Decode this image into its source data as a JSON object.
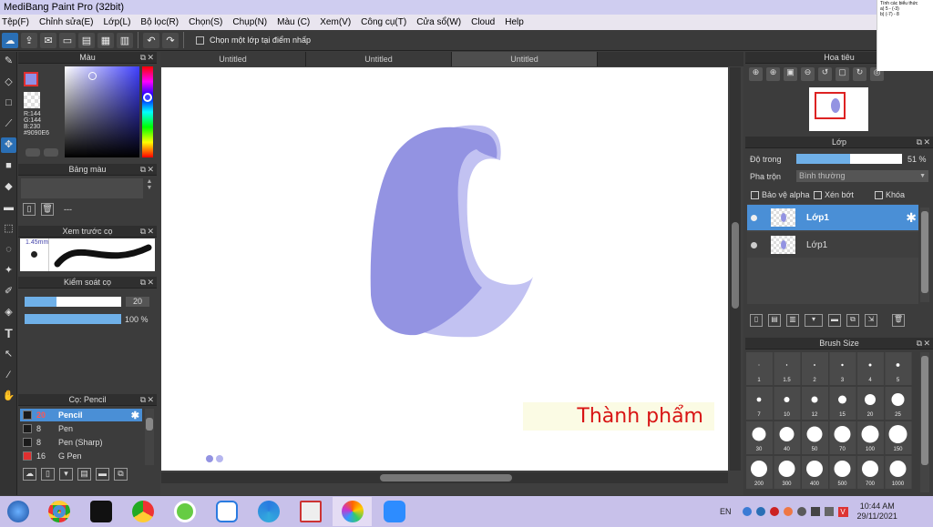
{
  "app": {
    "title": "MediBang Paint Pro (32bit)"
  },
  "menu": [
    "Tệp(F)",
    "Chỉnh sửa(E)",
    "Lớp(L)",
    "Bộ lọc(R)",
    "Chọn(S)",
    "Chụp(N)",
    "Màu (C)",
    "Xem(V)",
    "Công cụ(T)",
    "Cửa sổ(W)",
    "Cloud",
    "Help"
  ],
  "toolbar": {
    "checkbox_label": "Chọn một lớp tại điểm nhấp"
  },
  "overlay_note": {
    "line1": "Tính các biểu thức",
    "line2": "a) 5 - (-3)",
    "line3": "b) (-7) - 8"
  },
  "color_panel": {
    "title": "Màu",
    "r": "R:144",
    "g": "G:144",
    "b": "B:230",
    "hex": "#9090E6",
    "main_color": "#9090e6"
  },
  "palette_panel": {
    "title": "Bảng màu",
    "value": "---"
  },
  "brush_preview": {
    "title": "Xem trước cọ",
    "size": "1.45mm"
  },
  "brush_control": {
    "title": "Kiểm soát cọ",
    "size_value": "20",
    "opacity_value": "100 %",
    "size_fraction": 0.33,
    "opacity_fraction": 1.0
  },
  "brush_list": {
    "title": "Cọ: Pencil",
    "items": [
      {
        "size": "20",
        "name": "Pencil",
        "color": "#1a1a1a",
        "active": true
      },
      {
        "size": "8",
        "name": "Pen",
        "color": "#1a1a1a"
      },
      {
        "size": "8",
        "name": "Pen (Sharp)",
        "color": "#1a1a1a"
      },
      {
        "size": "16",
        "name": "G Pen",
        "color": "#e03030"
      }
    ]
  },
  "tabs": [
    "Untitled",
    "Untitled",
    "Untitled"
  ],
  "canvas": {
    "result_text": "Thành phẩm",
    "shape_color": "#9393e2",
    "shape_light": "#c0c0f2"
  },
  "navigator": {
    "title": "Hoa tiêu"
  },
  "layer_panel": {
    "title": "Lớp",
    "opacity_label": "Độ trong",
    "opacity_value": "51 %",
    "opacity_fraction": 0.51,
    "blend_label": "Pha trộn",
    "blend_value": "Bình thường",
    "protect_alpha": "Bảo vệ alpha",
    "clipping": "Xén bớt",
    "lock": "Khóa",
    "layers": [
      {
        "name": "Lớp1",
        "active": true
      },
      {
        "name": "Lớp1",
        "active": false
      }
    ]
  },
  "brush_size": {
    "title": "Brush Size",
    "sizes": [
      "1",
      "1.5",
      "2",
      "3",
      "4",
      "5",
      "7",
      "10",
      "12",
      "15",
      "20",
      "25",
      "30",
      "40",
      "50",
      "70",
      "100",
      "150",
      "200",
      "300",
      "400",
      "500",
      "700",
      "1000"
    ]
  },
  "taskbar": {
    "lang": "EN",
    "time": "10:44 AM",
    "date": "29/11/2021",
    "apps": [
      "Chrome",
      "CapCut",
      "Chrome",
      "Krita",
      "Zalo",
      "Edge",
      "Sheets",
      "MediBang",
      "Zoom"
    ]
  }
}
